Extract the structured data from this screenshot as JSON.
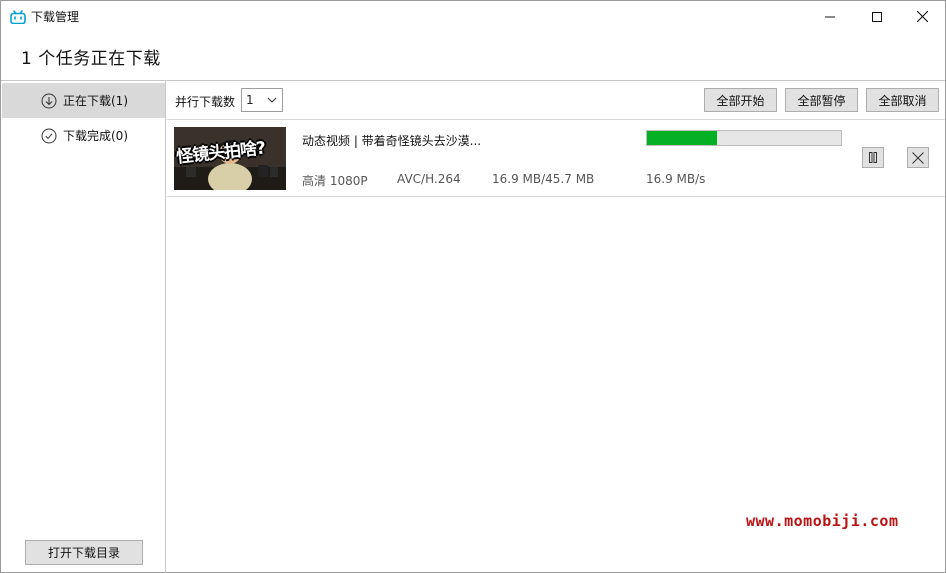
{
  "window": {
    "title": "下载管理",
    "icon": "bilibili-tv-icon",
    "controls": [
      "minimize-icon",
      "maximize-icon",
      "close-icon"
    ]
  },
  "heading": "1 个任务正在下载",
  "sidebar": {
    "items": [
      {
        "label": "正在下载(1)",
        "icon": "download-circle-icon",
        "active": true
      },
      {
        "label": "下载完成(0)",
        "icon": "check-circle-icon",
        "active": false
      }
    ],
    "open_folder_label": "打开下载目录"
  },
  "toolbar": {
    "parallel_label": "并行下载数",
    "parallel_value": "1",
    "start_all": "全部开始",
    "pause_all": "全部暂停",
    "cancel_all": "全部取消"
  },
  "tasks": [
    {
      "title": "动态视频 | 带着奇怪镜头去沙漠...",
      "thumbnail_text": "怪镜头拍啥?",
      "quality": "高清 1080P",
      "codec": "AVC/H.264",
      "size": "16.9 MB/45.7 MB",
      "speed": "16.9 MB/s",
      "progress_fraction": 0.36,
      "progress_color": "#06b025"
    }
  ],
  "watermark": "www.momobiji.com",
  "colors": {
    "accent": "#00a1d6",
    "watermark": "#b81414",
    "active_sidebar": "#d9d9d9"
  }
}
